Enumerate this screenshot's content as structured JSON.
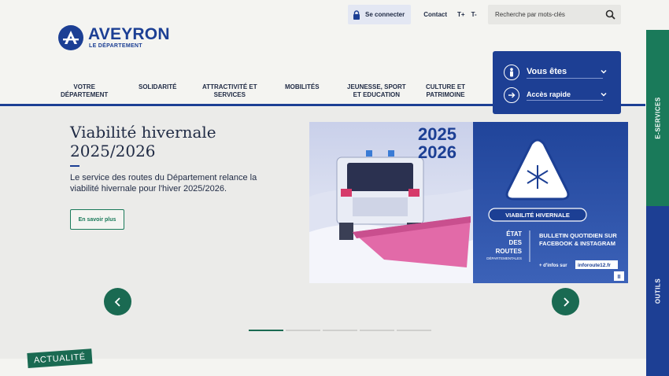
{
  "utility": {
    "login_label": "Se connecter",
    "contact_label": "Contact",
    "font_increase": "T+",
    "font_decrease": "T-"
  },
  "search": {
    "placeholder": "Recherche par mots-clés"
  },
  "logo": {
    "name": "AVEYRON",
    "subtitle": "LE DÉPARTEMENT"
  },
  "nav": {
    "items": [
      {
        "line1": "VOTRE",
        "line2": "DÉPARTEMENT"
      },
      {
        "line1": "SOLIDARITÉ",
        "line2": ""
      },
      {
        "line1": "ATTRACTIVITÉ ET",
        "line2": "SERVICES"
      },
      {
        "line1": "MOBILITÉS",
        "line2": ""
      },
      {
        "line1": "JEUNESSE, SPORT",
        "line2": "ET EDUCATION"
      },
      {
        "line1": "CULTURE ET",
        "line2": "PATRIMOINE"
      }
    ]
  },
  "quick": {
    "vous_etes": "Vous êtes",
    "acces_rapide": "Accès rapide"
  },
  "side_tabs": {
    "eservices": "E-SERVICES",
    "outils": "OUTILS"
  },
  "hero": {
    "title": "Viabilité hivernale 2025/2026",
    "text": "Le service des routes du Département relance la viabilité hivernale pour l'hiver 2025/2026.",
    "button": "En savoir plus",
    "image": {
      "year1": "2025",
      "year2": "2026",
      "sign_label": "VIABILITÉ HIVERNALE",
      "etat1": "ÉTAT",
      "etat2": "DES",
      "etat3": "ROUTES",
      "etat4": "DÉPARTEMENTALES",
      "bulletin1": "BULLETIN QUOTIDIEN SUR",
      "bulletin2": "FACEBOOK & INSTAGRAM",
      "infos_prefix": "+ d'infos sur",
      "infos_site": "inforoute12.fr",
      "pause": "II"
    }
  },
  "slider": {
    "count": 5,
    "active": 0
  },
  "section": {
    "actualite": "ACTUALITÉ"
  },
  "colors": {
    "brand_blue": "#1c3f94",
    "brand_green": "#1a7a5a",
    "dark_green": "#1a6a52"
  }
}
